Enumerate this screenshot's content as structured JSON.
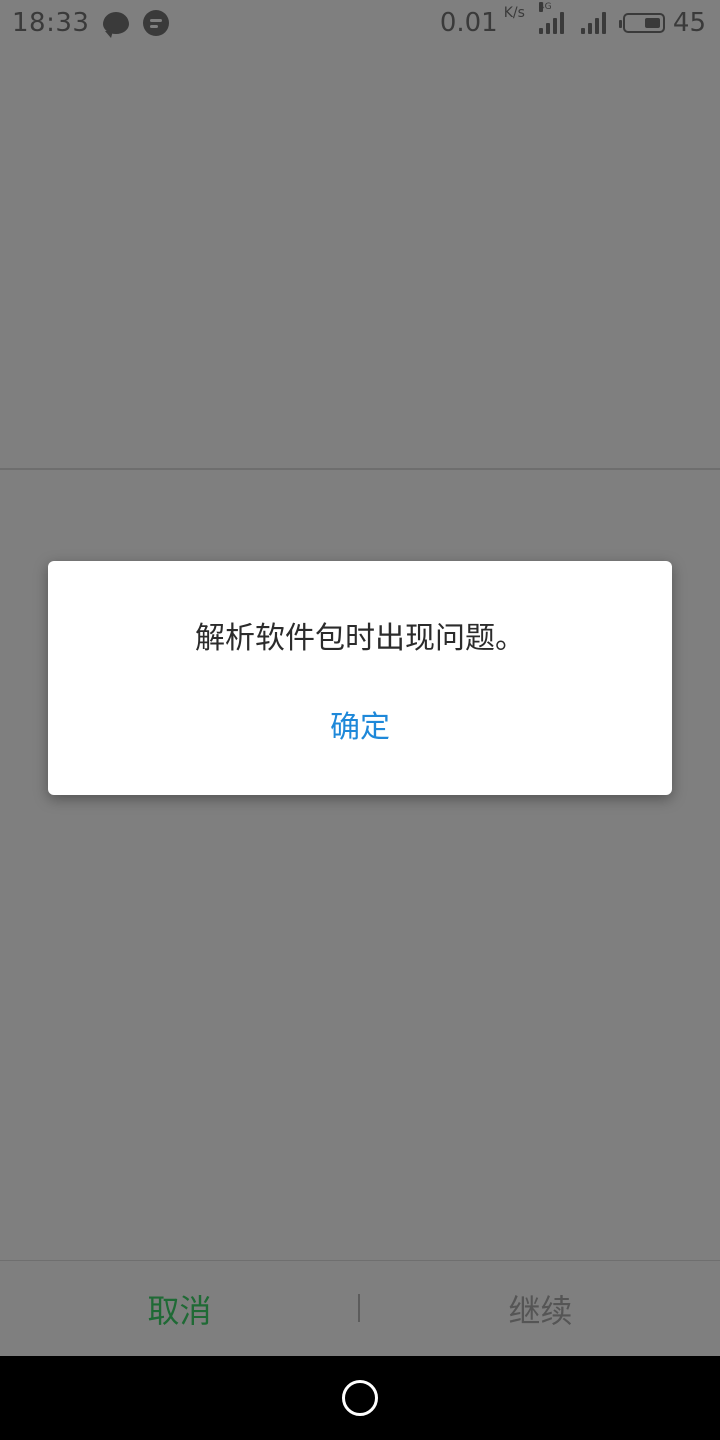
{
  "status_bar": {
    "time": "18:33",
    "notification_icons": [
      "chat-bubble-icon",
      "message-icon"
    ],
    "net_speed": "0.01",
    "net_speed_unit": "K/s",
    "network_type": "4G",
    "battery_level": "45"
  },
  "dialog": {
    "message": "解析软件包时出现问题。",
    "ok_label": "确定",
    "ok_color": "#1e88d9"
  },
  "bottom_bar": {
    "cancel_label": "取消",
    "continue_label": "继续",
    "cancel_color": "#1f6a35"
  },
  "nav_bar": {
    "home_icon": "home-circle-icon"
  }
}
